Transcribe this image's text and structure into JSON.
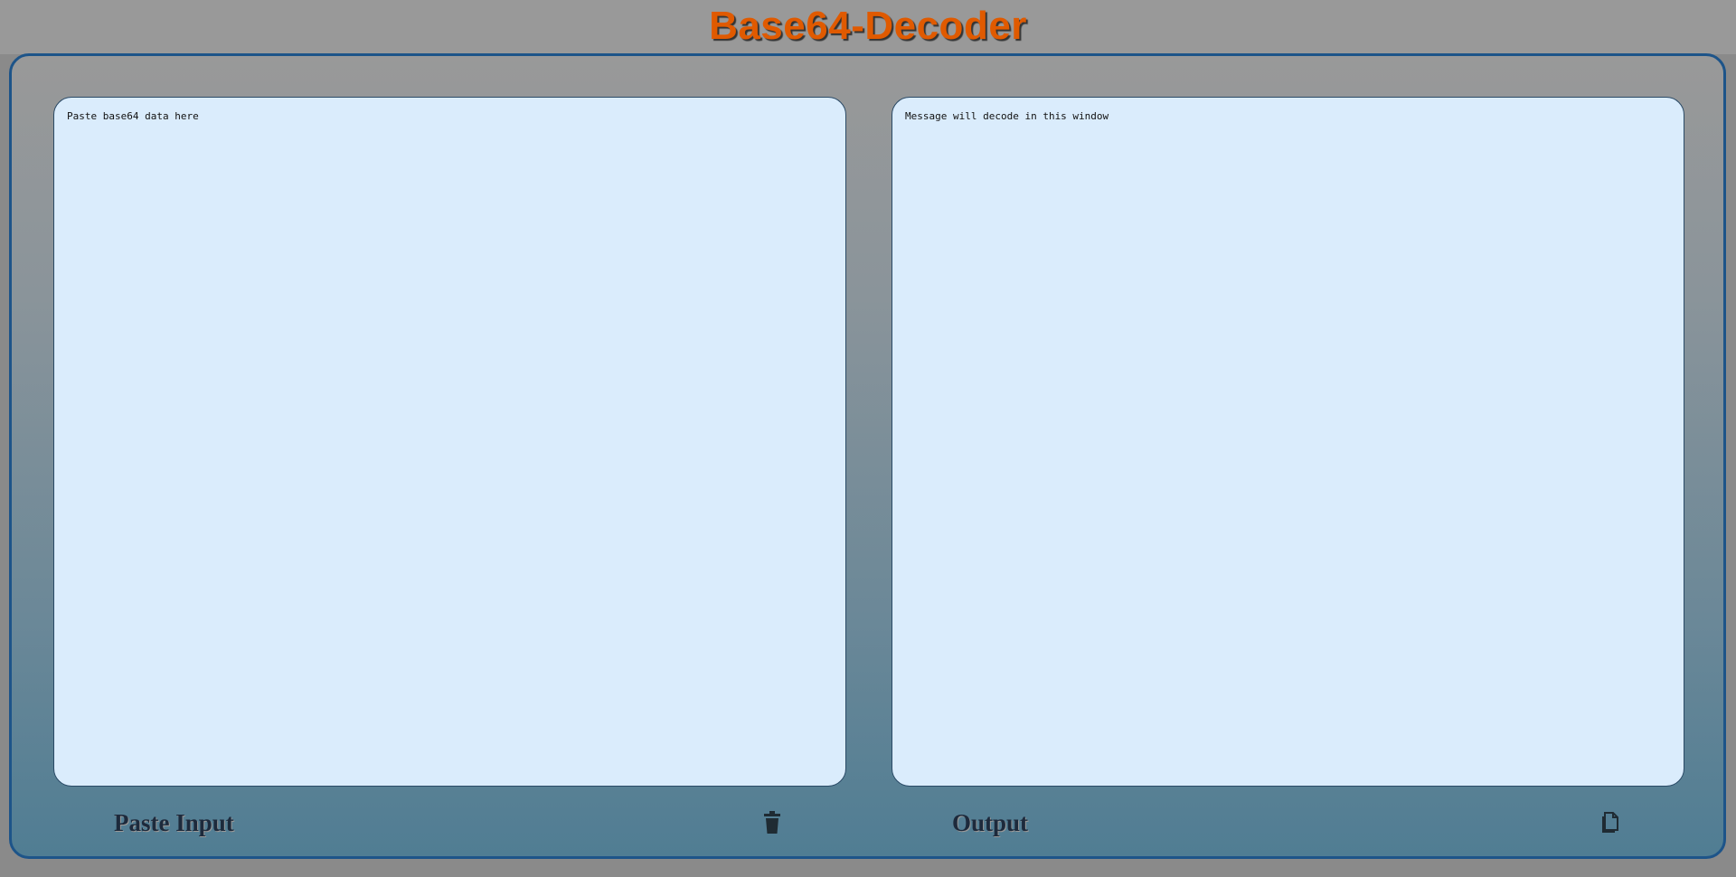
{
  "header": {
    "title": "Base64-Decoder"
  },
  "input": {
    "placeholder": "Paste base64 data here",
    "value": "",
    "label": "Paste Input",
    "action_icon": "trash-icon"
  },
  "output": {
    "placeholder": "Message will decode in this window",
    "value": "",
    "label": "Output",
    "action_icon": "copy-icon"
  },
  "colors": {
    "title": "#e05a00",
    "border": "#1d5489",
    "textarea_bg": "#daecfc"
  }
}
